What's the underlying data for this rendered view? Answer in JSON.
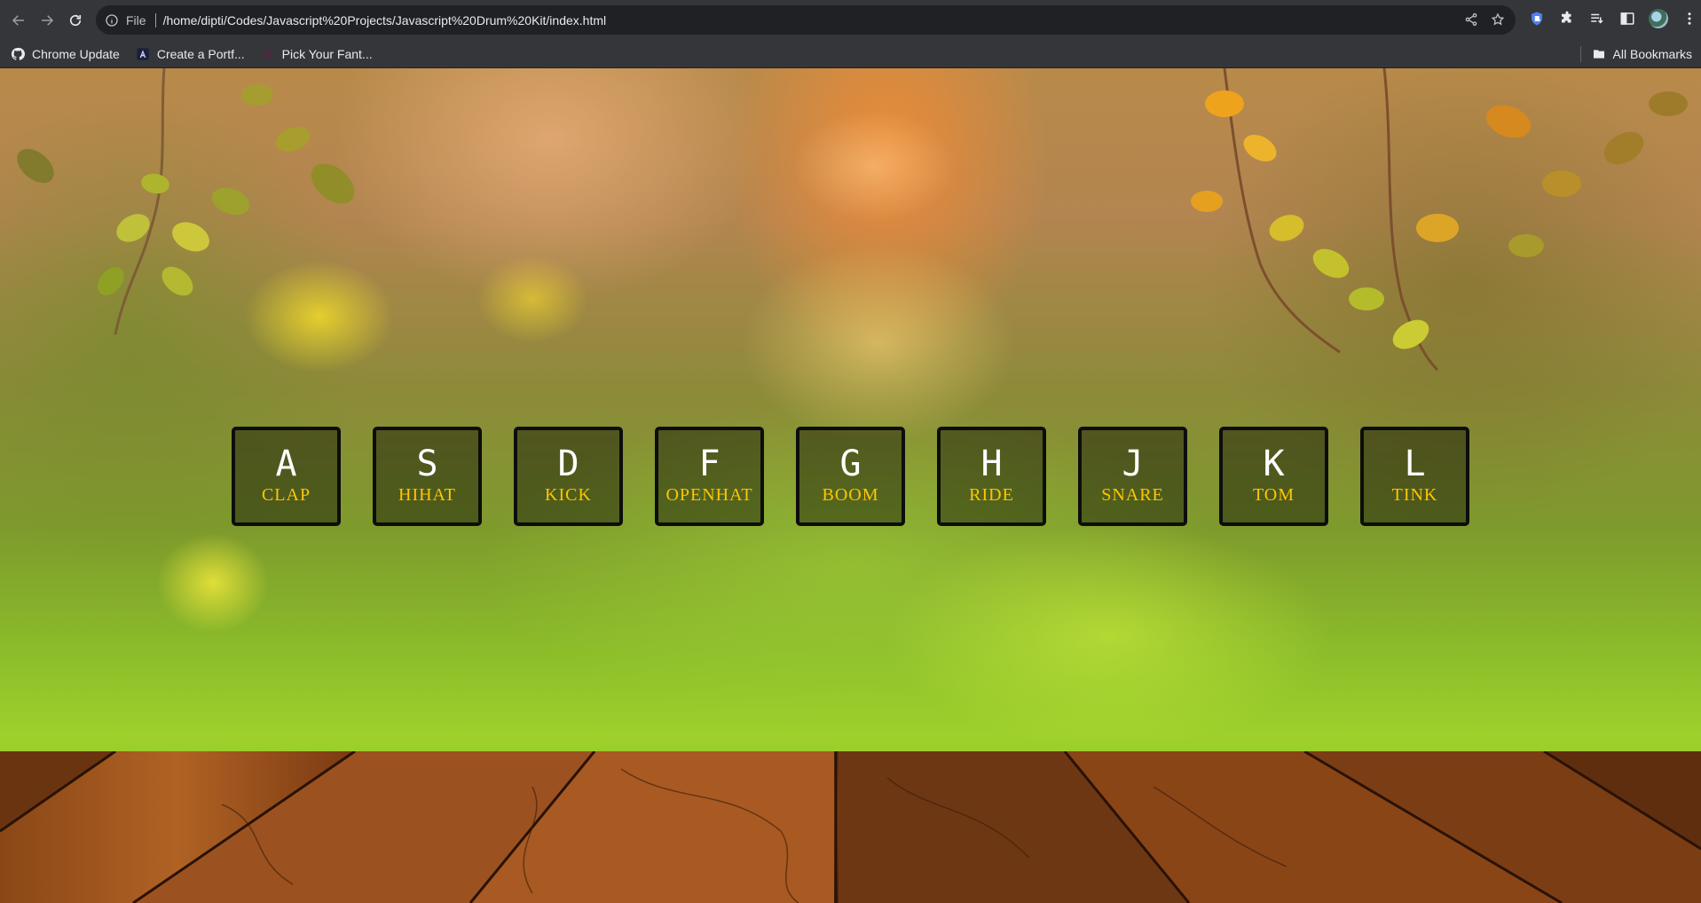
{
  "browser": {
    "scheme": "File",
    "url": "/home/dipti/Codes/Javascript%20Projects/Javascript%20Drum%20Kit/index.html",
    "bookmarks": [
      {
        "label": "Chrome Update",
        "icon": "github-icon"
      },
      {
        "label": "Create a Portf...",
        "icon": "angular-icon"
      },
      {
        "label": "Pick Your Fant...",
        "icon": "potion-icon"
      }
    ],
    "all_bookmarks_label": "All Bookmarks"
  },
  "drum_kit": {
    "keys": [
      {
        "key": "A",
        "sound": "CLAP"
      },
      {
        "key": "S",
        "sound": "HIHAT"
      },
      {
        "key": "D",
        "sound": "KICK"
      },
      {
        "key": "F",
        "sound": "OPENHAT"
      },
      {
        "key": "G",
        "sound": "BOOM"
      },
      {
        "key": "H",
        "sound": "RIDE"
      },
      {
        "key": "J",
        "sound": "SNARE"
      },
      {
        "key": "K",
        "sound": "TOM"
      },
      {
        "key": "L",
        "sound": "TINK"
      }
    ],
    "colors": {
      "sound_text": "#ffc600",
      "key_text": "#ffffff",
      "key_border": "#0d0d0d"
    }
  }
}
